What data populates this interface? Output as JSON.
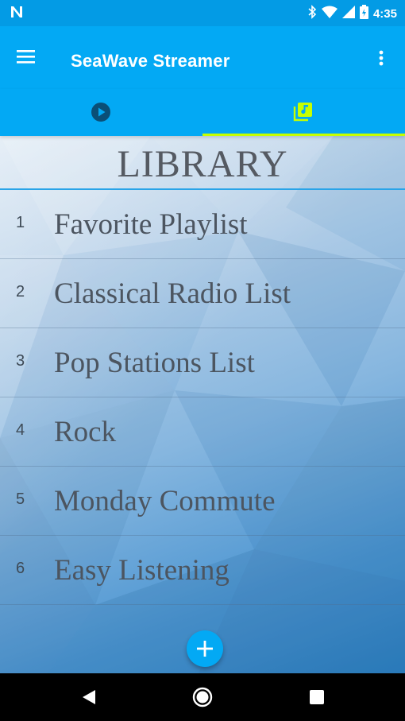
{
  "status_bar": {
    "time": "4:35",
    "icons": [
      "notification-n-icon",
      "bluetooth-icon",
      "wifi-icon",
      "signal-icon",
      "battery-icon"
    ]
  },
  "app_bar": {
    "title": "SeaWave Streamer",
    "menu_icon": "hamburger-menu-icon",
    "overflow_icon": "more-vert-icon"
  },
  "tabs": [
    {
      "icon": "play-circle-icon",
      "selected": false
    },
    {
      "icon": "library-music-icon",
      "selected": true
    }
  ],
  "library": {
    "title": "LIBRARY",
    "items": [
      {
        "num": "1",
        "label": "Favorite Playlist"
      },
      {
        "num": "2",
        "label": "Classical Radio List"
      },
      {
        "num": "3",
        "label": "Pop Stations List"
      },
      {
        "num": "4",
        "label": "Rock"
      },
      {
        "num": "5",
        "label": "Monday Commute"
      },
      {
        "num": "6",
        "label": "Easy Listening"
      }
    ]
  },
  "fab": {
    "icon": "add-icon"
  },
  "nav_bar": {
    "icons": [
      "back-icon",
      "home-icon",
      "recents-icon"
    ]
  },
  "colors": {
    "primary": "#03a9f4",
    "primary_dark": "#039be5",
    "tab_indicator": "#c6ff00",
    "header_rule": "#29a4e8"
  }
}
